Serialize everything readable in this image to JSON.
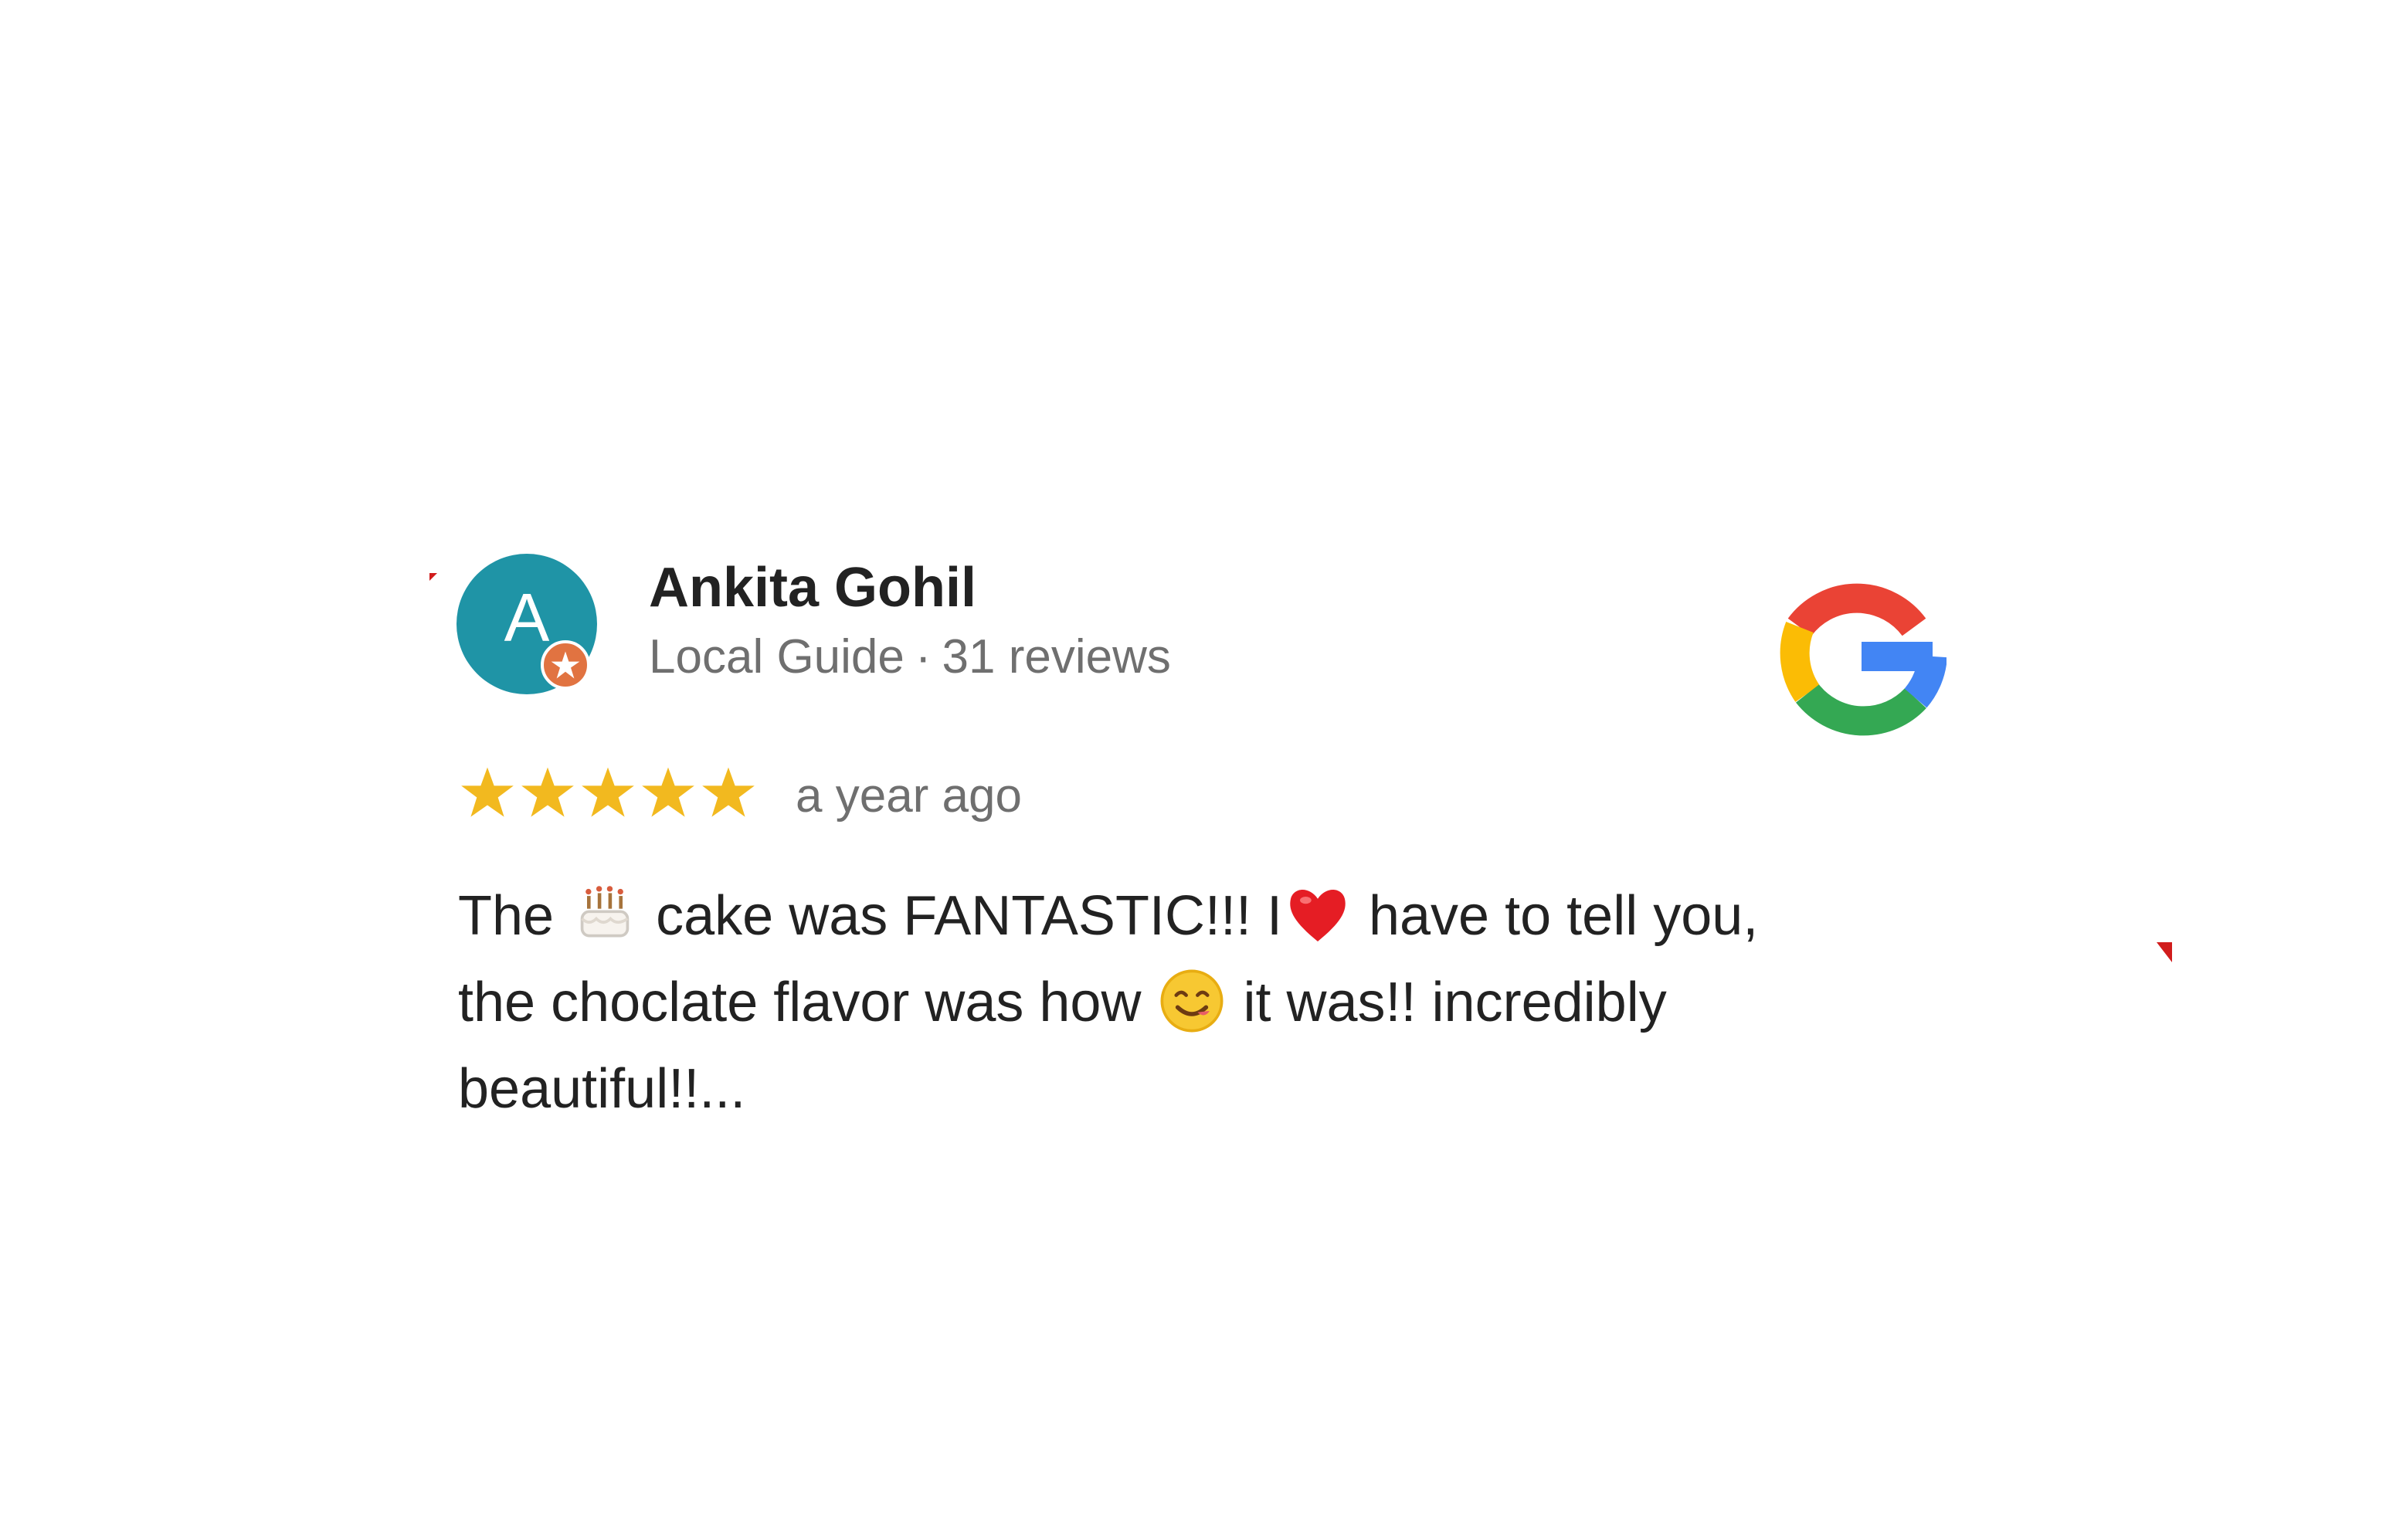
{
  "review": {
    "avatar_letter": "A",
    "reviewer_name": "Ankita Gohil",
    "reviewer_role": "Local Guide",
    "separator": "·",
    "reviewer_count": "31 reviews",
    "rating": 5,
    "rating_max": 5,
    "time_ago": "a year ago",
    "text_line_1_part_1": "The",
    "text_line_1_part_2": "cake was FANTASTIC!!! I",
    "text_line_1_part_3": "have to tell you,",
    "text_line_2_part_1": "the choclate flavor was  how",
    "text_line_2_part_2": "it was!!  incredibly",
    "text_line_3": "beautiful!!...",
    "icons": [
      "guide-star-icon",
      "google-g-icon",
      "star-icon",
      "birthday-cake-icon",
      "red-heart-icon",
      "smiling-face-icon"
    ]
  },
  "colors": {
    "avatar": "#1f94a6",
    "badge": "#e17341",
    "star": "#f2b91f",
    "google_red": "#ea4335",
    "google_yellow": "#fbbc05",
    "google_green": "#34a853",
    "google_blue": "#4285f4"
  }
}
